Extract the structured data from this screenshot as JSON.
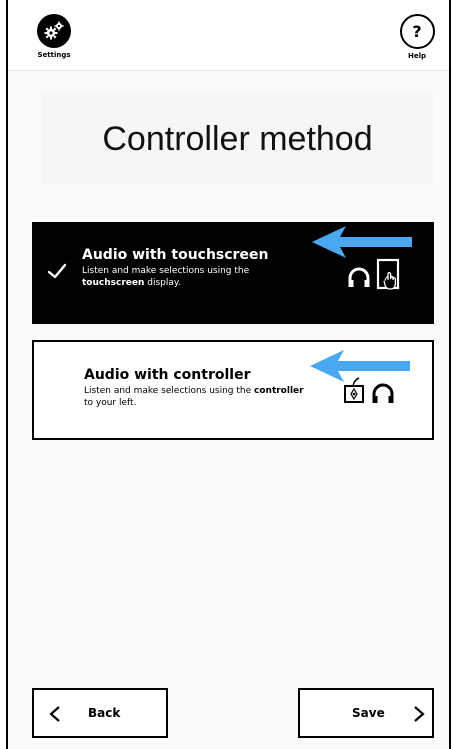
{
  "header": {
    "settings_label": "Settings",
    "help_glyph": "?",
    "help_label": "Help"
  },
  "page": {
    "title": "Controller method"
  },
  "options": [
    {
      "title": "Audio with touchscreen",
      "desc_pre": "Listen and make selections using the ",
      "desc_bold": "touchscreen",
      "desc_post": " display.",
      "selected": true,
      "icons": [
        "headphones-icon",
        "touchscreen-icon"
      ]
    },
    {
      "title": "Audio with controller",
      "desc_pre": "Listen and make selections using the ",
      "desc_bold": "controller",
      "desc_post": " to your left.",
      "selected": false,
      "icons": [
        "controller-icon",
        "headphones-icon"
      ]
    }
  ],
  "footer": {
    "back_label": "Back",
    "save_label": "Save"
  },
  "colors": {
    "selected_bg": "#000000",
    "arrow": "#4aa8f0"
  }
}
